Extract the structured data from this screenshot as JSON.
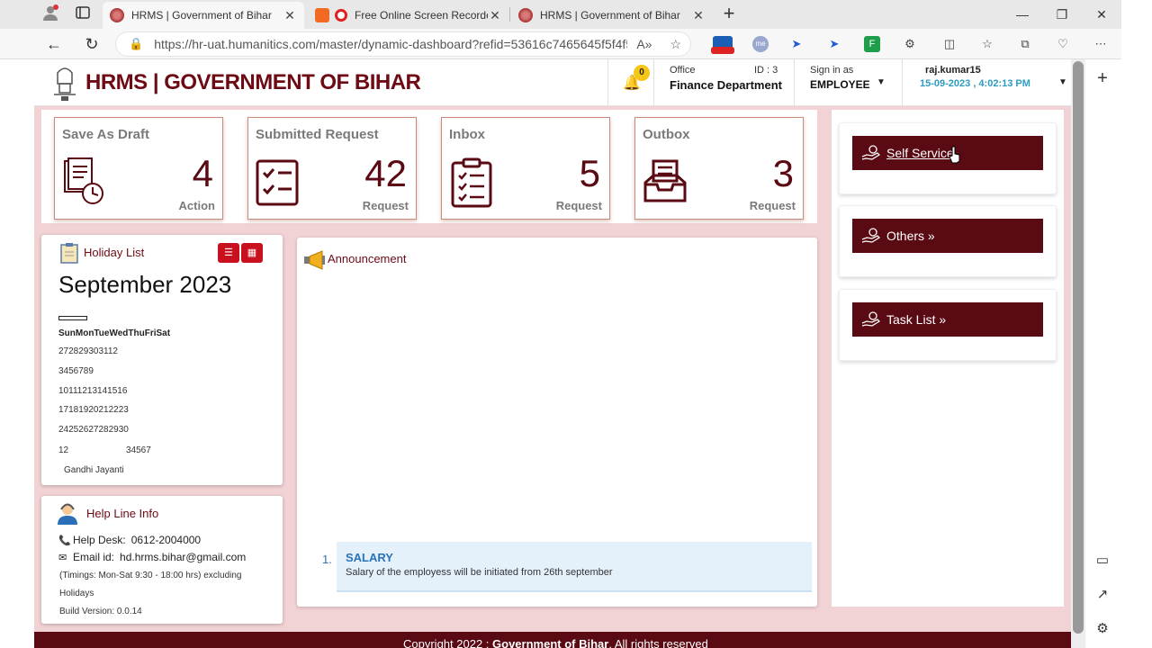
{
  "browser": {
    "tabs": [
      {
        "title": "HRMS | Government of Bihar",
        "active": true
      },
      {
        "title": "Free Online Screen Recorder",
        "active": false
      },
      {
        "title": "HRMS | Government of Bihar",
        "active": false
      }
    ],
    "url": "https://hr-uat.humanitics.com/master/dynamic-dashboard?refid=53616c7465645f5f4f5..."
  },
  "header": {
    "logo_text": "HRMS | GOVERNMENT OF BIHAR",
    "notification_count": "0",
    "office_label": "Office",
    "office_id": "ID : 3",
    "office_name": "Finance Department",
    "signin_label": "Sign in as",
    "signin_role": "EMPLOYEE",
    "username": "raj.kumar15",
    "datetime": "15-09-2023 , 4:02:13 PM"
  },
  "stats": [
    {
      "title": "Save As Draft",
      "value": "4",
      "unit": "Action"
    },
    {
      "title": "Submitted Request",
      "value": "42",
      "unit": "Request"
    },
    {
      "title": "Inbox",
      "value": "5",
      "unit": "Request"
    },
    {
      "title": "Outbox",
      "value": "3",
      "unit": "Request"
    }
  ],
  "holiday": {
    "title": "Holiday List",
    "month": "September 2023",
    "days_header": "SunMonTueWedThuFriSat",
    "rows": [
      "272829303112",
      "3456789",
      "10111213141516",
      "17181920212223",
      "24252627282930"
    ],
    "last_row_a": "12",
    "last_row_b": "34567",
    "holiday_name": "Gandhi Jayanti"
  },
  "helpline": {
    "title": "Help Line Info",
    "desk_label": "Help Desk:",
    "desk_value": "0612-2004000",
    "email_label": "Email id:",
    "email_value": "hd.hrms.bihar@gmail.com",
    "timings": "(Timings: Mon-Sat 9:30 - 18:00 hrs) excluding",
    "timings2": "Holidays",
    "build": "Build Version: 0.0.14"
  },
  "announcement": {
    "title": "Announcement",
    "items": [
      {
        "num": "1.",
        "heading": "SALARY",
        "text": "Salary of the employess will be initiated from 26th september"
      }
    ]
  },
  "quick": [
    {
      "label": "Self Service"
    },
    {
      "label": "Others »"
    },
    {
      "label": "Task List »"
    }
  ],
  "footer": {
    "pre": "Copyright 2022 : ",
    "org": "Government of Bihar",
    "post": ". All rights reserved"
  },
  "colors": {
    "brand": "#5a0a12",
    "background_tint": "#f2d3d5",
    "link_blue": "#2a73b8",
    "time_blue": "#2b9bbf",
    "badge_yellow": "#f5c518"
  }
}
